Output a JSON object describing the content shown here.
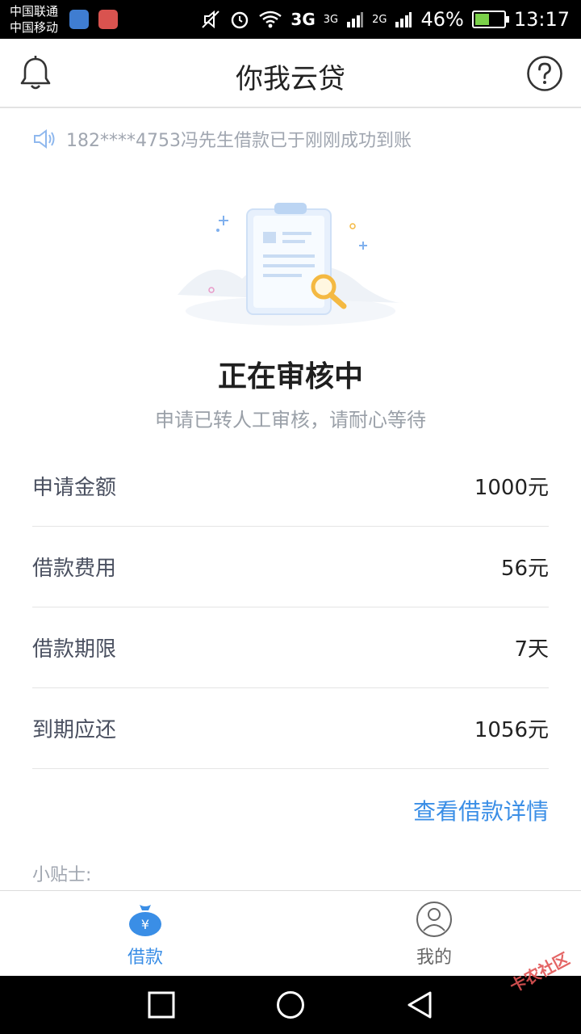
{
  "status_bar": {
    "carrier1": "中国联通",
    "carrier2": "中国移动",
    "net1": "3G",
    "net2": "3G",
    "net3": "2G",
    "battery": "46%",
    "time": "13:17"
  },
  "header": {
    "title": "你我云贷",
    "left_icon": "bell-icon",
    "right_icon": "help-icon"
  },
  "notice": {
    "text": "182****4753冯先生借款已于刚刚成功到账",
    "icon": "speaker-icon"
  },
  "status": {
    "title": "正在审核中",
    "subtitle": "申请已转人工审核，请耐心等待"
  },
  "details": [
    {
      "label": "申请金额",
      "value": "1000元"
    },
    {
      "label": "借款费用",
      "value": "56元"
    },
    {
      "label": "借款期限",
      "value": "7天"
    },
    {
      "label": "到期应还",
      "value": "1056元"
    }
  ],
  "detail_link": "查看借款详情",
  "tips_label": "小贴士:",
  "bottom_nav": {
    "loan": {
      "label": "借款",
      "icon": "money-bag-icon"
    },
    "mine": {
      "label": "我的",
      "icon": "user-icon"
    }
  },
  "watermark": "卡农社区",
  "colors": {
    "accent": "#3a8ee6",
    "muted": "#a0a6b0"
  }
}
